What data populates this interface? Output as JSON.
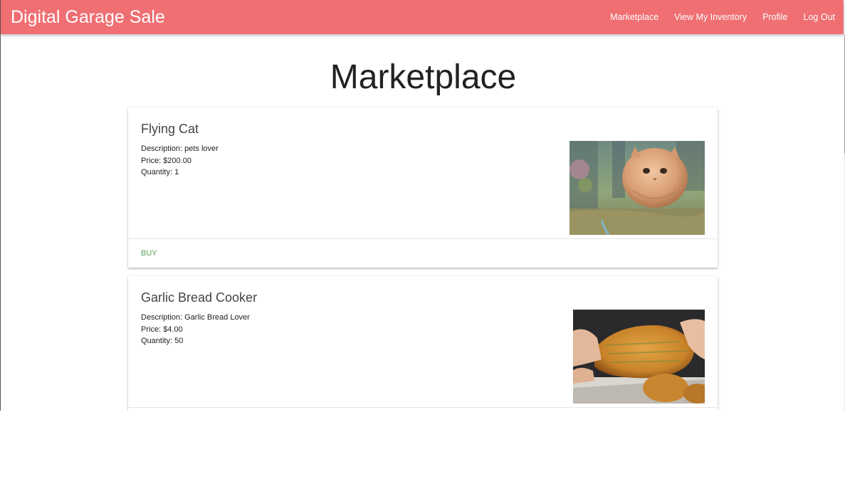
{
  "app": {
    "brand": "Digital Garage Sale",
    "accent_color": "#ef6f73"
  },
  "nav": {
    "links": [
      "Marketplace",
      "View My Inventory",
      "Profile",
      "Log Out"
    ]
  },
  "page": {
    "title": "Marketplace"
  },
  "listings": [
    {
      "name": "Flying Cat",
      "description": "Description: pets lover",
      "price": "Price: $200.00",
      "quantity": "Quantity: 1",
      "action": "BUY",
      "image_subject": "flying-cat-photo"
    },
    {
      "name": "Garlic Bread Cooker",
      "description": "Description: Garlic Bread Lover",
      "price": "Price: $4.00",
      "quantity": "Quantity: 50",
      "image_subject": "garlic-bread-photo"
    }
  ]
}
